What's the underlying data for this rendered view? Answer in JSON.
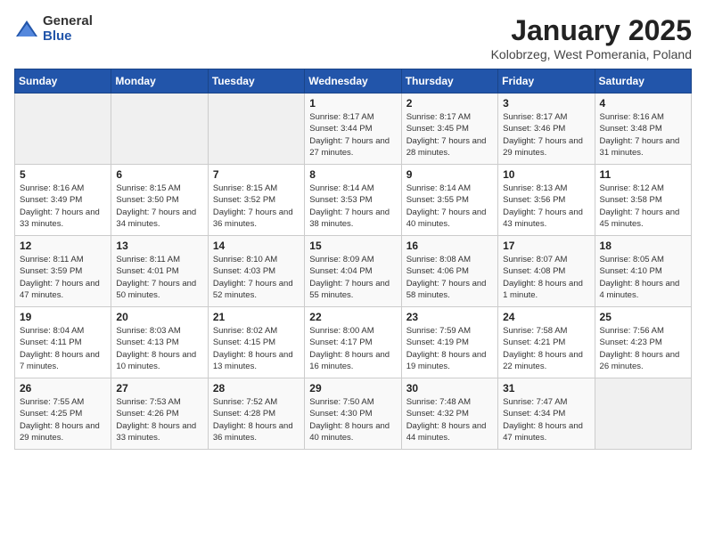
{
  "header": {
    "logo_general": "General",
    "logo_blue": "Blue",
    "title": "January 2025",
    "location": "Kolobrzeg, West Pomerania, Poland"
  },
  "weekdays": [
    "Sunday",
    "Monday",
    "Tuesday",
    "Wednesday",
    "Thursday",
    "Friday",
    "Saturday"
  ],
  "weeks": [
    [
      {
        "day": "",
        "sunrise": "",
        "sunset": "",
        "daylight": ""
      },
      {
        "day": "",
        "sunrise": "",
        "sunset": "",
        "daylight": ""
      },
      {
        "day": "",
        "sunrise": "",
        "sunset": "",
        "daylight": ""
      },
      {
        "day": "1",
        "sunrise": "Sunrise: 8:17 AM",
        "sunset": "Sunset: 3:44 PM",
        "daylight": "Daylight: 7 hours and 27 minutes."
      },
      {
        "day": "2",
        "sunrise": "Sunrise: 8:17 AM",
        "sunset": "Sunset: 3:45 PM",
        "daylight": "Daylight: 7 hours and 28 minutes."
      },
      {
        "day": "3",
        "sunrise": "Sunrise: 8:17 AM",
        "sunset": "Sunset: 3:46 PM",
        "daylight": "Daylight: 7 hours and 29 minutes."
      },
      {
        "day": "4",
        "sunrise": "Sunrise: 8:16 AM",
        "sunset": "Sunset: 3:48 PM",
        "daylight": "Daylight: 7 hours and 31 minutes."
      }
    ],
    [
      {
        "day": "5",
        "sunrise": "Sunrise: 8:16 AM",
        "sunset": "Sunset: 3:49 PM",
        "daylight": "Daylight: 7 hours and 33 minutes."
      },
      {
        "day": "6",
        "sunrise": "Sunrise: 8:15 AM",
        "sunset": "Sunset: 3:50 PM",
        "daylight": "Daylight: 7 hours and 34 minutes."
      },
      {
        "day": "7",
        "sunrise": "Sunrise: 8:15 AM",
        "sunset": "Sunset: 3:52 PM",
        "daylight": "Daylight: 7 hours and 36 minutes."
      },
      {
        "day": "8",
        "sunrise": "Sunrise: 8:14 AM",
        "sunset": "Sunset: 3:53 PM",
        "daylight": "Daylight: 7 hours and 38 minutes."
      },
      {
        "day": "9",
        "sunrise": "Sunrise: 8:14 AM",
        "sunset": "Sunset: 3:55 PM",
        "daylight": "Daylight: 7 hours and 40 minutes."
      },
      {
        "day": "10",
        "sunrise": "Sunrise: 8:13 AM",
        "sunset": "Sunset: 3:56 PM",
        "daylight": "Daylight: 7 hours and 43 minutes."
      },
      {
        "day": "11",
        "sunrise": "Sunrise: 8:12 AM",
        "sunset": "Sunset: 3:58 PM",
        "daylight": "Daylight: 7 hours and 45 minutes."
      }
    ],
    [
      {
        "day": "12",
        "sunrise": "Sunrise: 8:11 AM",
        "sunset": "Sunset: 3:59 PM",
        "daylight": "Daylight: 7 hours and 47 minutes."
      },
      {
        "day": "13",
        "sunrise": "Sunrise: 8:11 AM",
        "sunset": "Sunset: 4:01 PM",
        "daylight": "Daylight: 7 hours and 50 minutes."
      },
      {
        "day": "14",
        "sunrise": "Sunrise: 8:10 AM",
        "sunset": "Sunset: 4:03 PM",
        "daylight": "Daylight: 7 hours and 52 minutes."
      },
      {
        "day": "15",
        "sunrise": "Sunrise: 8:09 AM",
        "sunset": "Sunset: 4:04 PM",
        "daylight": "Daylight: 7 hours and 55 minutes."
      },
      {
        "day": "16",
        "sunrise": "Sunrise: 8:08 AM",
        "sunset": "Sunset: 4:06 PM",
        "daylight": "Daylight: 7 hours and 58 minutes."
      },
      {
        "day": "17",
        "sunrise": "Sunrise: 8:07 AM",
        "sunset": "Sunset: 4:08 PM",
        "daylight": "Daylight: 8 hours and 1 minute."
      },
      {
        "day": "18",
        "sunrise": "Sunrise: 8:05 AM",
        "sunset": "Sunset: 4:10 PM",
        "daylight": "Daylight: 8 hours and 4 minutes."
      }
    ],
    [
      {
        "day": "19",
        "sunrise": "Sunrise: 8:04 AM",
        "sunset": "Sunset: 4:11 PM",
        "daylight": "Daylight: 8 hours and 7 minutes."
      },
      {
        "day": "20",
        "sunrise": "Sunrise: 8:03 AM",
        "sunset": "Sunset: 4:13 PM",
        "daylight": "Daylight: 8 hours and 10 minutes."
      },
      {
        "day": "21",
        "sunrise": "Sunrise: 8:02 AM",
        "sunset": "Sunset: 4:15 PM",
        "daylight": "Daylight: 8 hours and 13 minutes."
      },
      {
        "day": "22",
        "sunrise": "Sunrise: 8:00 AM",
        "sunset": "Sunset: 4:17 PM",
        "daylight": "Daylight: 8 hours and 16 minutes."
      },
      {
        "day": "23",
        "sunrise": "Sunrise: 7:59 AM",
        "sunset": "Sunset: 4:19 PM",
        "daylight": "Daylight: 8 hours and 19 minutes."
      },
      {
        "day": "24",
        "sunrise": "Sunrise: 7:58 AM",
        "sunset": "Sunset: 4:21 PM",
        "daylight": "Daylight: 8 hours and 22 minutes."
      },
      {
        "day": "25",
        "sunrise": "Sunrise: 7:56 AM",
        "sunset": "Sunset: 4:23 PM",
        "daylight": "Daylight: 8 hours and 26 minutes."
      }
    ],
    [
      {
        "day": "26",
        "sunrise": "Sunrise: 7:55 AM",
        "sunset": "Sunset: 4:25 PM",
        "daylight": "Daylight: 8 hours and 29 minutes."
      },
      {
        "day": "27",
        "sunrise": "Sunrise: 7:53 AM",
        "sunset": "Sunset: 4:26 PM",
        "daylight": "Daylight: 8 hours and 33 minutes."
      },
      {
        "day": "28",
        "sunrise": "Sunrise: 7:52 AM",
        "sunset": "Sunset: 4:28 PM",
        "daylight": "Daylight: 8 hours and 36 minutes."
      },
      {
        "day": "29",
        "sunrise": "Sunrise: 7:50 AM",
        "sunset": "Sunset: 4:30 PM",
        "daylight": "Daylight: 8 hours and 40 minutes."
      },
      {
        "day": "30",
        "sunrise": "Sunrise: 7:48 AM",
        "sunset": "Sunset: 4:32 PM",
        "daylight": "Daylight: 8 hours and 44 minutes."
      },
      {
        "day": "31",
        "sunrise": "Sunrise: 7:47 AM",
        "sunset": "Sunset: 4:34 PM",
        "daylight": "Daylight: 8 hours and 47 minutes."
      },
      {
        "day": "",
        "sunrise": "",
        "sunset": "",
        "daylight": ""
      }
    ]
  ]
}
